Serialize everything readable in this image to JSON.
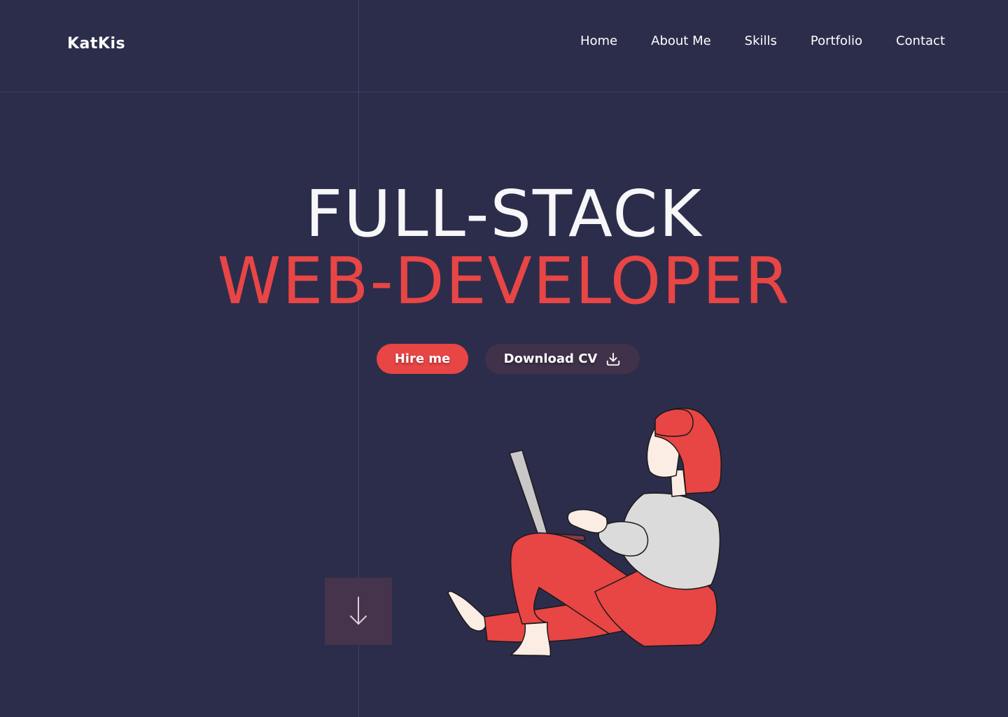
{
  "header": {
    "logo": "KatKis",
    "nav": [
      "Home",
      "About Me",
      "Skills",
      "Portfolio",
      "Contact"
    ]
  },
  "hero": {
    "title_line1": "FULL-STACK",
    "title_line2": "WEB-DEVELOPER",
    "hire_label": "Hire me",
    "cv_label": "Download CV"
  },
  "icons": {
    "download": "download-icon",
    "scroll": "arrow-down-icon"
  },
  "colors": {
    "background": "#2c2d4b",
    "accent": "#e84545",
    "secondary_button": "#40324a",
    "scroll_box": "#45344b",
    "text": "#ffffff"
  }
}
